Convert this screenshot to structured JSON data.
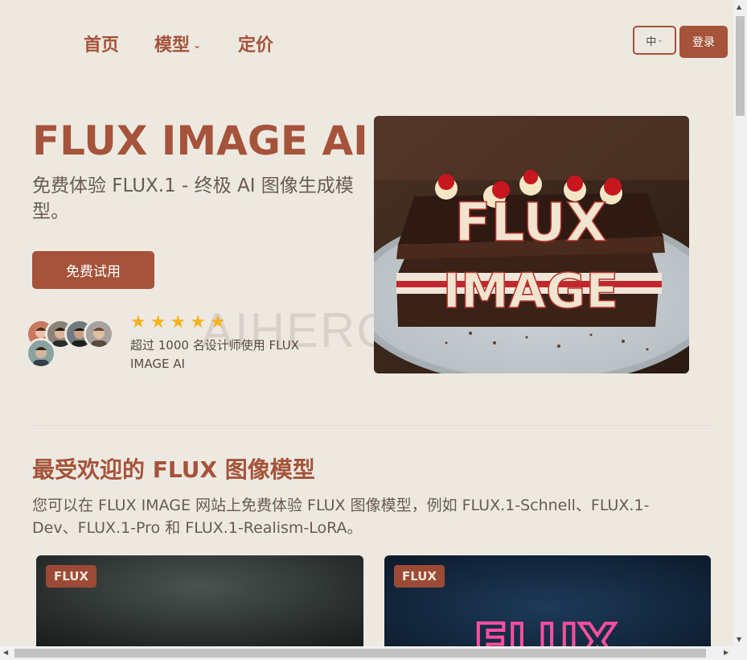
{
  "nav": {
    "home": "首页",
    "models": "模型",
    "pricing": "定价",
    "language": "中",
    "login": "登录"
  },
  "hero": {
    "title": "FLUX IMAGE AI",
    "subtitle": "免费体验 FLUX.1 - 终极 AI 图像生成模型。",
    "cta": "免费试用",
    "rating_stars": 5,
    "social_proof": "超过 1000 名设计师使用 FLUX IMAGE AI",
    "watermark": "AIHERO",
    "image_text_top": "FLUX",
    "image_text_bottom": "IMAGE"
  },
  "section": {
    "title": "最受欢迎的 FLUX 图像模型",
    "description": "您可以在 FLUX IMAGE 网站上免费体验 FLUX 图像模型，例如 FLUX.1-Schnell、FLUX.1-Dev、FLUX.1-Pro 和 FLUX.1-Realism-LoRA。"
  },
  "cards": [
    {
      "badge": "FLUX"
    },
    {
      "badge": "FLUX",
      "neon_text": "FLUX"
    }
  ],
  "colors": {
    "accent": "#a5533a",
    "background": "#ede9e1",
    "star": "#f2b31c"
  }
}
